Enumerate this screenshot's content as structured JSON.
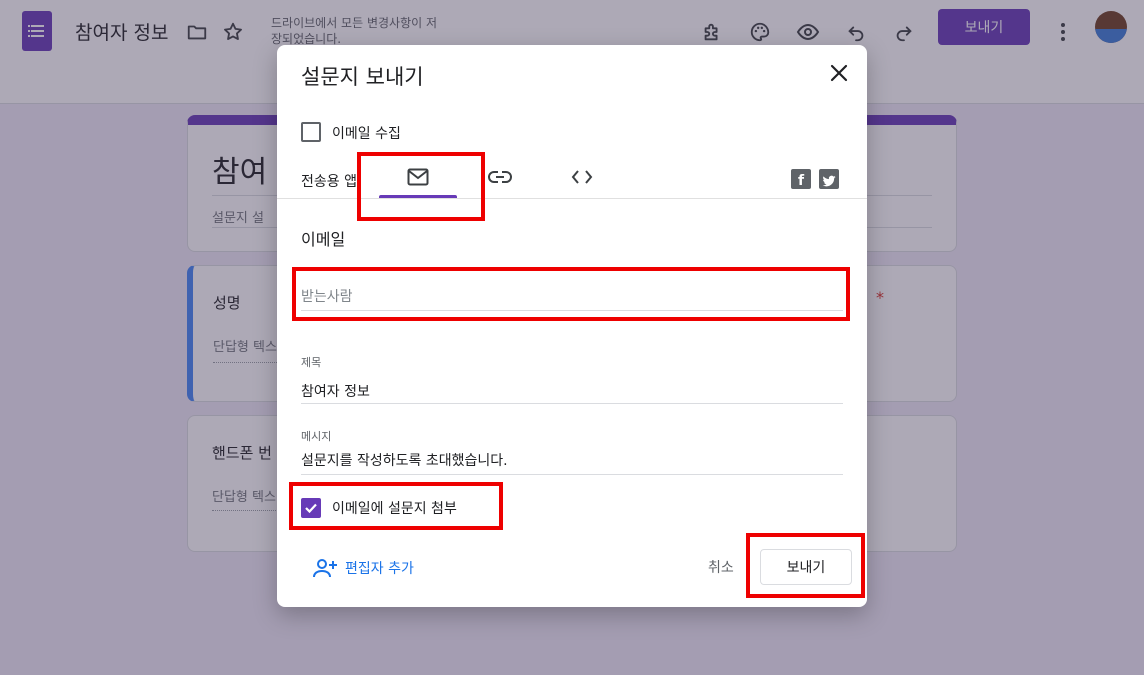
{
  "header": {
    "doc_title": "참여자 정보",
    "save_status": "드라이브에서 모든 변경사항이 저장되었습니다.",
    "send_label": "보내기"
  },
  "form": {
    "title": "참여",
    "description": "설문지 설",
    "questions": [
      {
        "title": "성명",
        "type_hint": "단답형 텍스"
      },
      {
        "title": "핸드폰 번",
        "type_hint": "단답형 텍스"
      }
    ],
    "required_mark": "*"
  },
  "dialog": {
    "title": "설문지 보내기",
    "collect_email_label": "이메일 수집",
    "collect_email_checked": false,
    "send_via_label": "전송용 앱:",
    "tabs": [
      "email",
      "link",
      "embed"
    ],
    "active_tab": "email",
    "section_title": "이메일",
    "recipient_placeholder": "받는사람",
    "subject_label": "제목",
    "subject_value": "참여자 정보",
    "message_label": "메시지",
    "message_value": "설문지를 작성하도록 초대했습니다.",
    "include_form_label": "이메일에 설문지 첨부",
    "include_form_checked": true,
    "add_editor_label": "편집자 추가",
    "cancel_label": "취소",
    "send_label": "보내기"
  },
  "colors": {
    "accent": "#673ab7",
    "highlight": "#ee0000",
    "link": "#1a73e8"
  }
}
